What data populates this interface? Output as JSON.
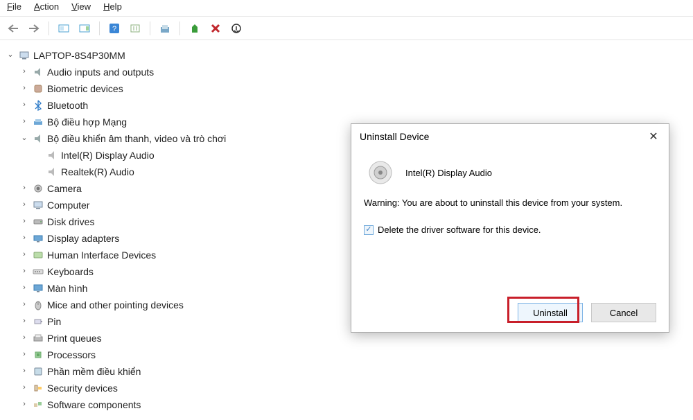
{
  "menubar": {
    "file": "File",
    "action": "Action",
    "view": "View",
    "help": "Help"
  },
  "tree": {
    "root": "LAPTOP-8S4P30MM",
    "items": [
      {
        "label": "Audio inputs and outputs"
      },
      {
        "label": "Biometric devices"
      },
      {
        "label": "Bluetooth"
      },
      {
        "label": "Bộ điều hợp Mạng"
      },
      {
        "label": "Bộ điều khiển âm thanh, video và trò chơi",
        "expanded": true,
        "children": [
          {
            "label": "Intel(R) Display Audio"
          },
          {
            "label": "Realtek(R) Audio"
          }
        ]
      },
      {
        "label": "Camera"
      },
      {
        "label": "Computer"
      },
      {
        "label": "Disk drives"
      },
      {
        "label": "Display adapters"
      },
      {
        "label": "Human Interface Devices"
      },
      {
        "label": "Keyboards"
      },
      {
        "label": "Màn hình"
      },
      {
        "label": "Mice and other pointing devices"
      },
      {
        "label": "Pin"
      },
      {
        "label": "Print queues"
      },
      {
        "label": "Processors"
      },
      {
        "label": "Phần mềm điều khiển"
      },
      {
        "label": "Security devices"
      },
      {
        "label": "Software components"
      }
    ]
  },
  "dialog": {
    "title": "Uninstall Device",
    "device_name": "Intel(R) Display Audio",
    "warning": "Warning: You are about to uninstall this device from your system.",
    "checkbox_label": "Delete the driver software for this device.",
    "checkbox_checked": true,
    "uninstall": "Uninstall",
    "cancel": "Cancel"
  },
  "icons": {
    "speaker": "speaker-icon",
    "computer": "computer-icon"
  }
}
